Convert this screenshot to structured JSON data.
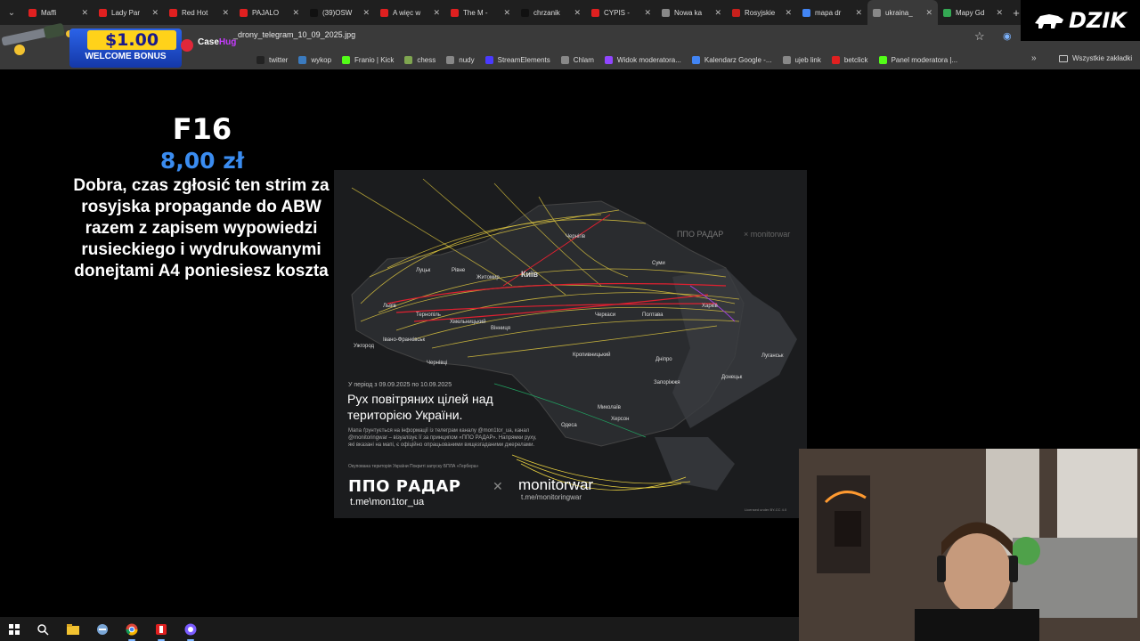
{
  "browser": {
    "tabs": [
      {
        "label": "Maffi",
        "color": "#e02020"
      },
      {
        "label": "Lady Par",
        "color": "#e02020"
      },
      {
        "label": "Red Hot",
        "color": "#e02020"
      },
      {
        "label": "PAJALO",
        "color": "#e02020"
      },
      {
        "label": "(39)OSW",
        "color": "#111111"
      },
      {
        "label": "A więc w",
        "color": "#e02020"
      },
      {
        "label": "The M -",
        "color": "#e02020"
      },
      {
        "label": "chrzanik",
        "color": "#111111"
      },
      {
        "label": "CYPIS -",
        "color": "#e02020"
      },
      {
        "label": "Nowa ka",
        "color": "#888888"
      },
      {
        "label": "Rosyjskie",
        "color": "#c8201c"
      },
      {
        "label": "mapa dr",
        "color": "#4285f4"
      },
      {
        "label": "ukraina_",
        "color": "#888888"
      },
      {
        "label": "Mapy Gd",
        "color": "#34a853"
      }
    ],
    "close_glyph": "✕",
    "new_tab_glyph": "+",
    "url": "_drony_telegram_10_09_2025.jpg",
    "bookmarks": [
      {
        "label": "twitter",
        "color": "#222222"
      },
      {
        "label": "wykop",
        "color": "#3b7bbf"
      },
      {
        "label": "Franio | Kick",
        "color": "#53fc18"
      },
      {
        "label": "chess",
        "color": "#7fa650"
      },
      {
        "label": "nudy",
        "color": "#888888"
      },
      {
        "label": "StreamElements",
        "color": "#4a3aff"
      },
      {
        "label": "Chlam",
        "color": "#888888"
      },
      {
        "label": "Widok moderatora...",
        "color": "#9146ff"
      },
      {
        "label": "Kalendarz Google -...",
        "color": "#4285f4"
      },
      {
        "label": "ujeb link",
        "color": "#888888"
      },
      {
        "label": "betclick",
        "color": "#e02020"
      },
      {
        "label": "Panel moderatora |...",
        "color": "#53fc18"
      }
    ],
    "bookmarks_more": "»",
    "all_bookmarks": "Wszystkie zakładki"
  },
  "ad": {
    "amount": "$1.00",
    "text": "WELCOME BONUS",
    "brand_a": "Case",
    "brand_b": "Hug"
  },
  "stream_logo": "DZIK",
  "donation": {
    "name": "F16",
    "amount": "8,00 zł",
    "message": "Dobra, czas zgłosić ten strim za rosyjska propagande do ABW razem z zapisem wypowiedzi rusieckiego i wydrukowanymi donejtami A4 poniesiesz koszta"
  },
  "map": {
    "period": "У період з 09.09.2025 по 10.09.2025",
    "title": "Рух повітряних цілей над територією України.",
    "description": "Мапа ґрунтується на інформації із телеграм каналу @mon1tor_ua, канал @monitoringwar – візуалізує її за принципом «ППО РАДАР». Напрямки руху, які вказані на мапі, є офіційно опрацьованими вищезгаданими джерелами.",
    "legend": "Окупована територія України   Покриті запуску БПЛА «Гербера»",
    "brand1": "ППО РАДАР",
    "brand1_sub": "t.me\\mon1tor_ua",
    "brand_x": "✕",
    "brand2": "monitorwar",
    "brand2_sub": "t.me/monitoringwar",
    "wm1": "ППО РАДАР",
    "wm2": "× monitorwar",
    "credit": "Licensed under BY-CC 4.0",
    "cities": [
      {
        "name": "Київ",
        "big": true
      },
      {
        "name": "Луцьк"
      },
      {
        "name": "Рівне"
      },
      {
        "name": "Житомир"
      },
      {
        "name": "Чернігів"
      },
      {
        "name": "Суми"
      },
      {
        "name": "Львів"
      },
      {
        "name": "Тернопіль"
      },
      {
        "name": "Хмельницький"
      },
      {
        "name": "Вінниця"
      },
      {
        "name": "Черкаси"
      },
      {
        "name": "Полтава"
      },
      {
        "name": "Харків"
      },
      {
        "name": "Ужгород"
      },
      {
        "name": "Івано-Франківськ"
      },
      {
        "name": "Чернівці"
      },
      {
        "name": "Кропивницький"
      },
      {
        "name": "Дніпро"
      },
      {
        "name": "Луганськ"
      },
      {
        "name": "Запоріжжя"
      },
      {
        "name": "Донецьк"
      },
      {
        "name": "Миколаїв"
      },
      {
        "name": "Херсон"
      },
      {
        "name": "Одеса"
      }
    ]
  },
  "taskbar": {
    "items": [
      "start-icon",
      "search-icon",
      "file-explorer-icon",
      "app-icon",
      "chrome-icon",
      "media-icon",
      "chrome-profile-icon"
    ]
  }
}
